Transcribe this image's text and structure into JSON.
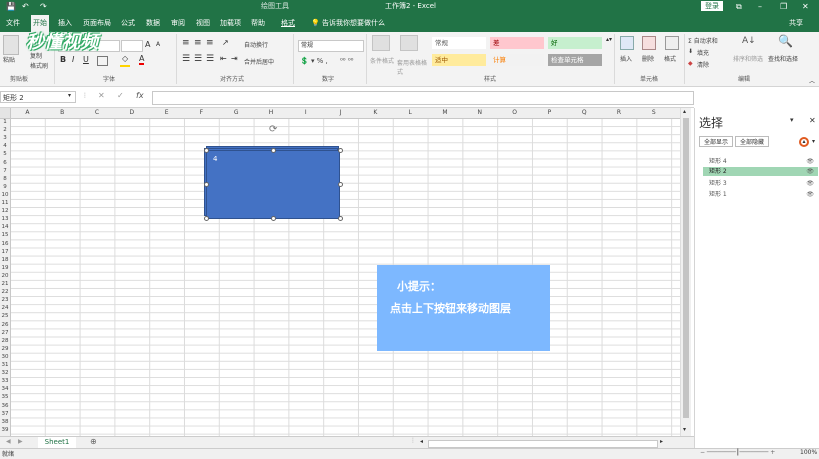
{
  "window": {
    "drawing_tools_label": "绘图工具",
    "title": "工作簿2 - Excel",
    "login_button": "登录",
    "controls": {
      "ribbon_display": "⧉",
      "minimize": "–",
      "restore": "❐",
      "close": "✕"
    }
  },
  "quick_access": {
    "save_icon": "💾",
    "undo_icon": "↶",
    "redo_icon": "↷"
  },
  "tabs": [
    {
      "label": "文件"
    },
    {
      "label": "开始"
    },
    {
      "label": "插入"
    },
    {
      "label": "页面布局"
    },
    {
      "label": "公式"
    },
    {
      "label": "数据"
    },
    {
      "label": "审阅"
    },
    {
      "label": "视图"
    },
    {
      "label": "加载项"
    },
    {
      "label": "帮助"
    },
    {
      "label": "格式"
    }
  ],
  "tell_me": "告诉我你想要做什么",
  "share": "共享",
  "watermark": "秒懂视频",
  "ribbon": {
    "clipboard": {
      "paste": "粘贴",
      "copy": "复制",
      "format_painter": "格式刷",
      "label": "剪贴板"
    },
    "font": {
      "label": "字体",
      "bold": "B",
      "italic": "I",
      "underline": "U"
    },
    "alignment": {
      "wrap": "自动换行",
      "merge": "合并后居中",
      "label": "对齐方式"
    },
    "number": {
      "format": "常规",
      "label": "数字"
    },
    "styles": {
      "conditional": "条件格式",
      "table": "套用表格格式",
      "cells": [
        {
          "text": "常规",
          "bg": "#ffffff",
          "fg": "#555555"
        },
        {
          "text": "差",
          "bg": "#ffc7ce",
          "fg": "#9c0006"
        },
        {
          "text": "好",
          "bg": "#c6efce",
          "fg": "#006100"
        },
        {
          "text": "适中",
          "bg": "#ffeb9c",
          "fg": "#9c5700"
        },
        {
          "text": "计算",
          "bg": "#f2f2f2",
          "fg": "#fa7d00"
        },
        {
          "text": "检查单元格",
          "bg": "#a5a5a5",
          "fg": "#ffffff"
        }
      ],
      "label": "样式"
    },
    "cells": {
      "insert": "插入",
      "delete": "删除",
      "format": "格式",
      "label": "单元格"
    },
    "editing": {
      "sum": "Σ 自动求和",
      "fill": "填充",
      "clear": "清除",
      "sort": "排序和筛选",
      "find": "查找和选择",
      "label": "编辑"
    }
  },
  "formula_bar": {
    "name_box": "矩形 2",
    "fx": "fx",
    "cancel": "✕",
    "confirm": "✓",
    "value": ""
  },
  "columns": [
    "A",
    "B",
    "C",
    "D",
    "E",
    "F",
    "G",
    "H",
    "I",
    "J",
    "K",
    "L",
    "M",
    "N",
    "O",
    "P",
    "Q",
    "R",
    "S"
  ],
  "rows": [
    "1",
    "2",
    "3",
    "4",
    "5",
    "6",
    "7",
    "8",
    "9",
    "10",
    "11",
    "12",
    "13",
    "14",
    "15",
    "16",
    "17",
    "18",
    "19",
    "20",
    "21",
    "22",
    "23",
    "24",
    "25",
    "26",
    "27",
    "28",
    "29",
    "30",
    "31",
    "32",
    "33",
    "34",
    "35",
    "36",
    "37",
    "38",
    "39"
  ],
  "shape_text": "4",
  "tip": {
    "title": "小提示：",
    "body": "点击上下按钮来移动图层"
  },
  "pane": {
    "title": "选择",
    "show_all": "全部显示",
    "hide_all": "全部隐藏",
    "items": [
      {
        "label": "矩形 4",
        "selected": false
      },
      {
        "label": "矩形 2",
        "selected": true
      },
      {
        "label": "矩形 3",
        "selected": false
      },
      {
        "label": "矩形 1",
        "selected": false
      }
    ]
  },
  "sheet_tab": "Sheet1",
  "status": {
    "ready": "就绪",
    "zoom": "100%"
  }
}
